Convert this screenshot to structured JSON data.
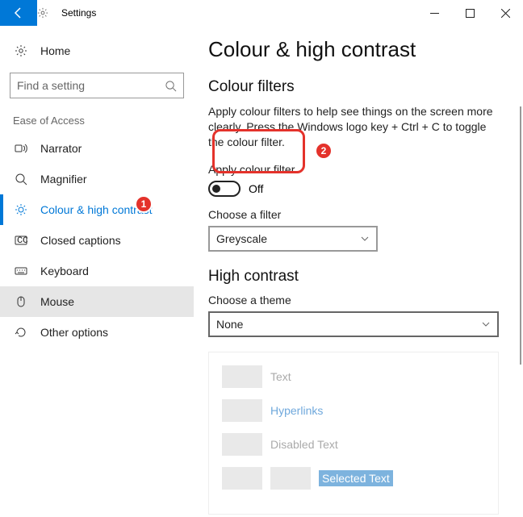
{
  "title": "Settings",
  "search": {
    "placeholder": "Find a setting"
  },
  "home_label": "Home",
  "group_label": "Ease of Access",
  "nav": [
    {
      "label": "Narrator"
    },
    {
      "label": "Magnifier"
    },
    {
      "label": "Colour & high contrast"
    },
    {
      "label": "Closed captions"
    },
    {
      "label": "Keyboard"
    },
    {
      "label": "Mouse"
    },
    {
      "label": "Other options"
    }
  ],
  "page": {
    "heading": "Colour & high contrast",
    "section1_title": "Colour filters",
    "section1_desc": "Apply colour filters to help see things on the screen more clearly. Press the Windows logo key + Ctrl + C to toggle the colour filter.",
    "toggle_label": "Apply colour filter",
    "toggle_value": "Off",
    "filter_label": "Choose a filter",
    "filter_value": "Greyscale",
    "section2_title": "High contrast",
    "theme_label": "Choose a theme",
    "theme_value": "None",
    "preview": {
      "text_label": "Text",
      "hyper_label": "Hyperlinks",
      "disabled_label": "Disabled Text",
      "selected_label": "Selected Text"
    }
  },
  "callouts": {
    "one": "1",
    "two": "2"
  }
}
